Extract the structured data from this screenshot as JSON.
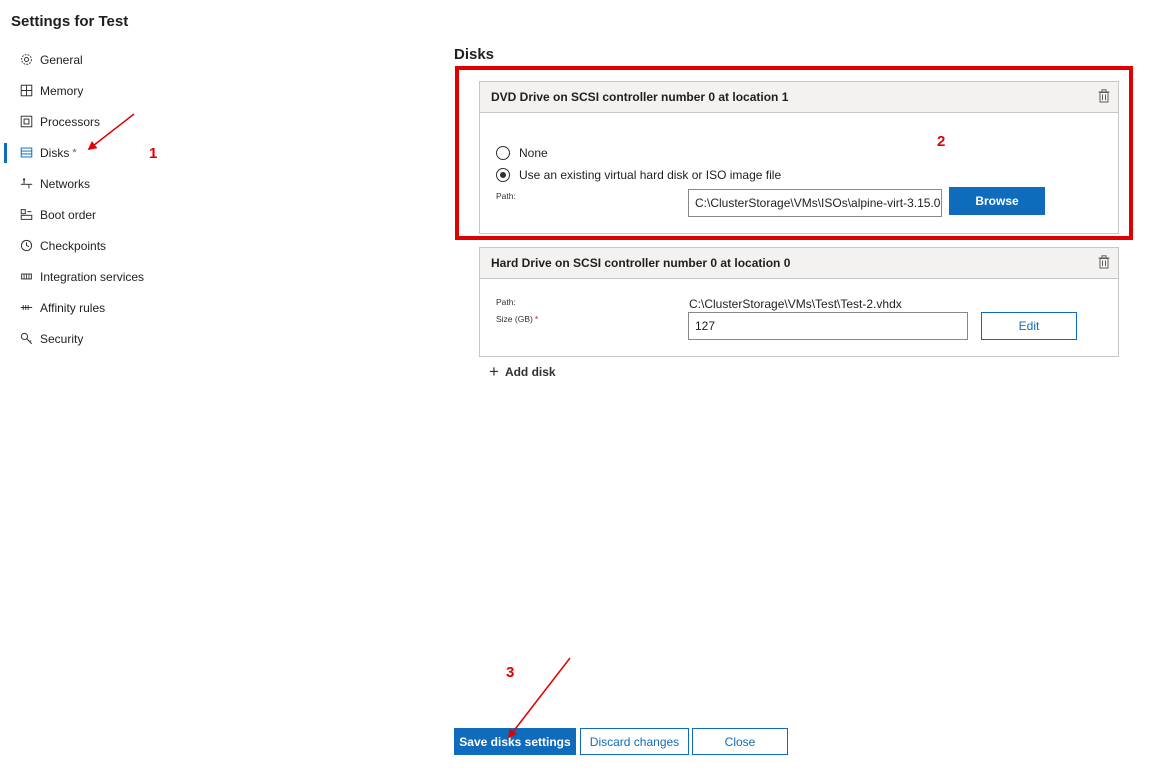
{
  "page": {
    "title": "Settings for Test"
  },
  "nav": {
    "items": [
      {
        "label": "General",
        "icon": "gear-icon"
      },
      {
        "label": "Memory",
        "icon": "memory-icon"
      },
      {
        "label": "Processors",
        "icon": "processor-icon"
      },
      {
        "label": "Disks",
        "icon": "disk-icon",
        "active": true,
        "dirty": "*"
      },
      {
        "label": "Networks",
        "icon": "network-icon"
      },
      {
        "label": "Boot order",
        "icon": "boot-order-icon"
      },
      {
        "label": "Checkpoints",
        "icon": "clock-icon"
      },
      {
        "label": "Integration services",
        "icon": "integration-icon"
      },
      {
        "label": "Affinity rules",
        "icon": "affinity-icon"
      },
      {
        "label": "Security",
        "icon": "key-icon"
      }
    ]
  },
  "main": {
    "section_title": "Disks",
    "dvd_card": {
      "header": "DVD Drive on SCSI controller number 0 at location 1",
      "option_none": "None",
      "option_existing": "Use an existing virtual hard disk or ISO image file",
      "selected": "existing",
      "path_label": "Path:",
      "path_value": "C:\\ClusterStorage\\VMs\\ISOs\\alpine-virt-3.15.0",
      "browse_label": "Browse"
    },
    "hdd_card": {
      "header": "Hard Drive on SCSI controller number 0 at location 0",
      "path_label": "Path:",
      "path_value": "C:\\ClusterStorage\\VMs\\Test\\Test-2.vhdx",
      "size_label": "Size (GB)",
      "size_required": "*",
      "size_value": "127",
      "edit_label": "Edit"
    },
    "add_disk_label": "Add disk"
  },
  "footer": {
    "save_label": "Save disks settings",
    "discard_label": "Discard changes",
    "close_label": "Close"
  },
  "annotations": {
    "one": "1",
    "two": "2",
    "three": "3"
  },
  "colors": {
    "accent": "#0f6cbd",
    "annotation": "#e00000"
  }
}
